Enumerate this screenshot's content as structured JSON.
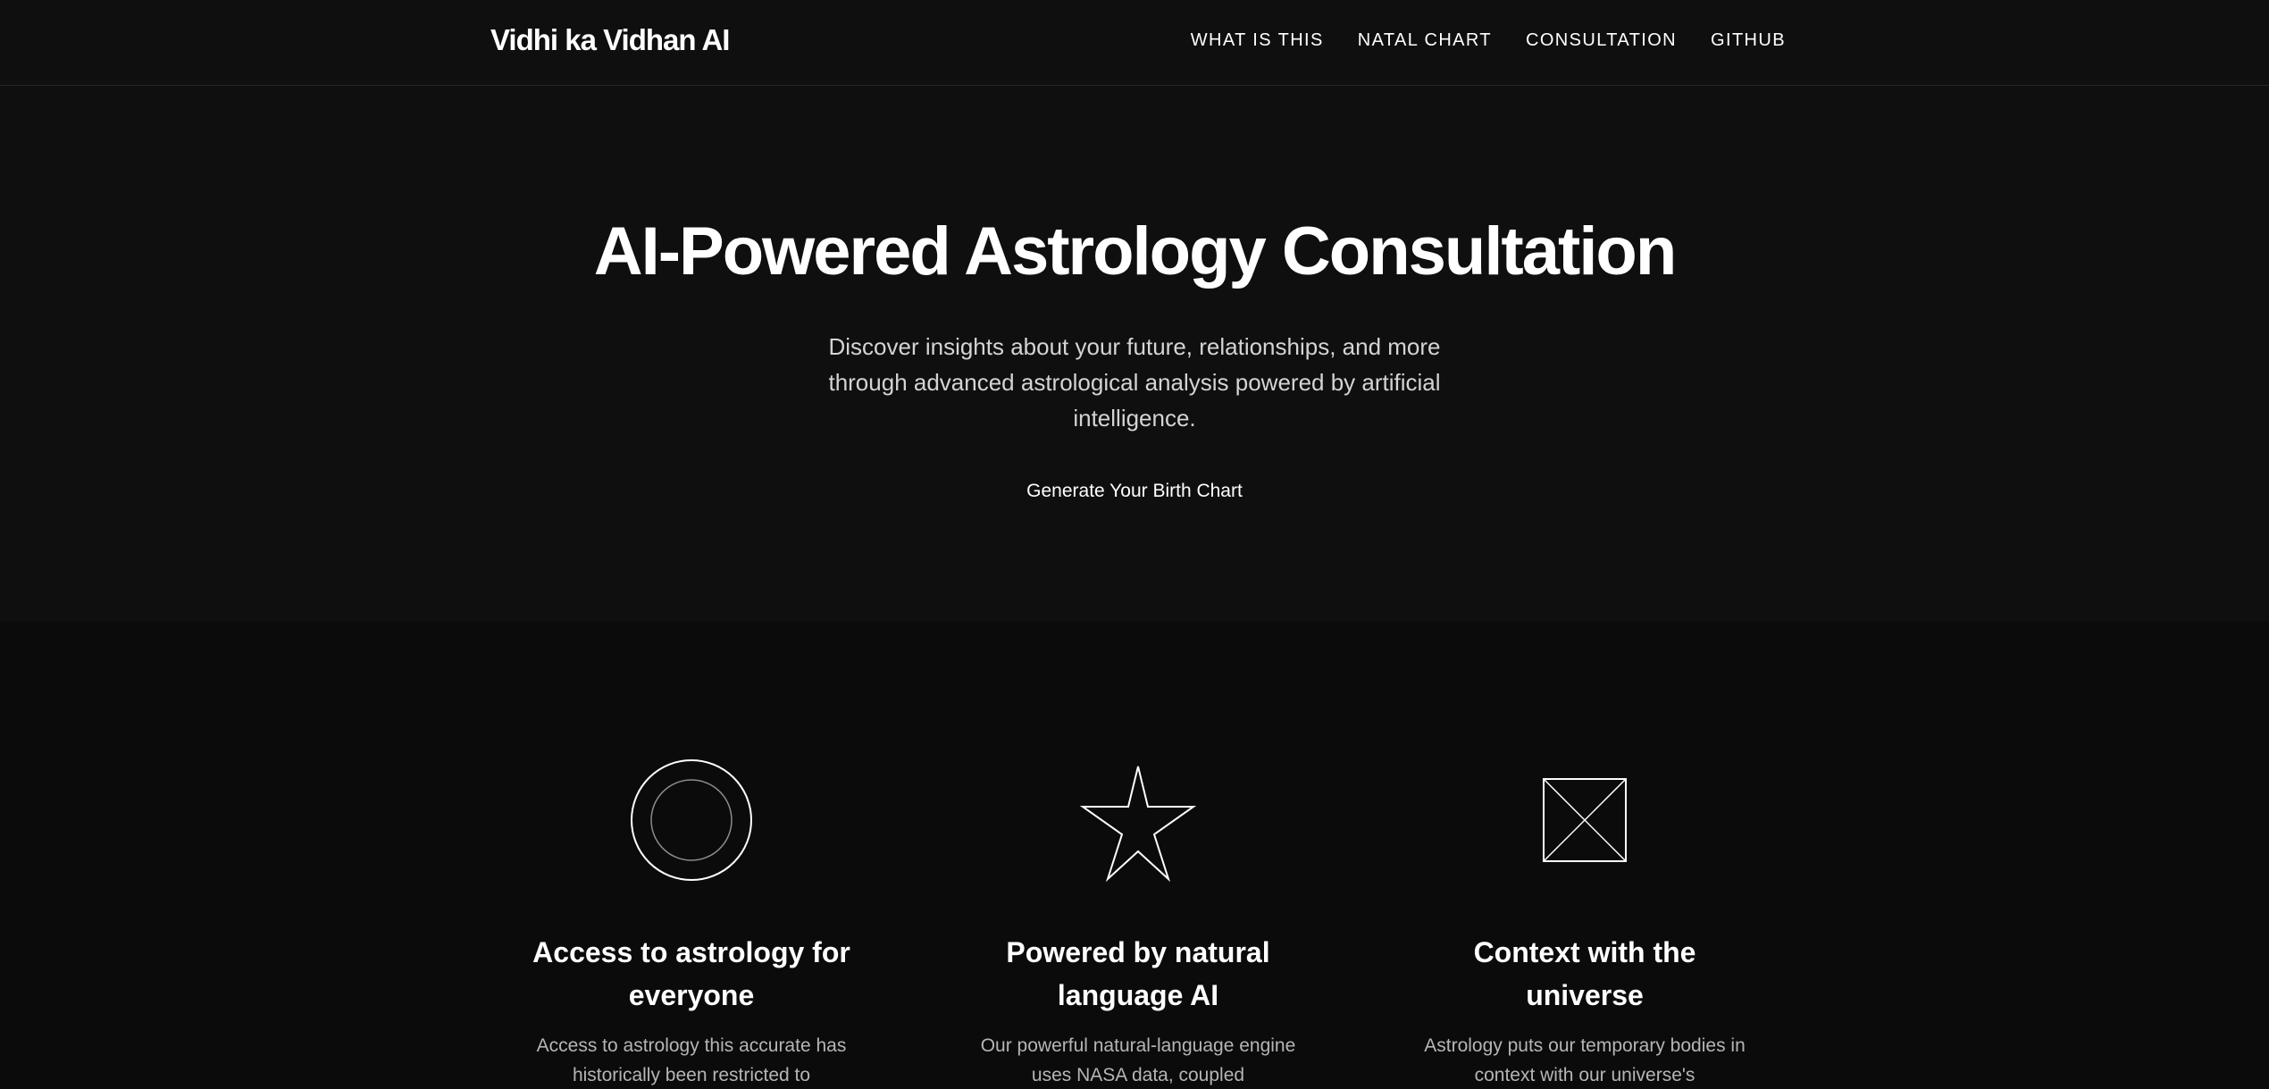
{
  "header": {
    "brand": "Vidhi ka Vidhan AI",
    "nav": [
      "WHAT IS THIS",
      "NATAL CHART",
      "CONSULTATION",
      "GITHUB"
    ]
  },
  "hero": {
    "title": "AI-Powered Astrology Consultation",
    "subtitle": "Discover insights about your future, relationships, and more through advanced astrological analysis powered by artificial intelligence.",
    "cta_label": "Generate Your Birth Chart"
  },
  "features": [
    {
      "icon": "double-circle-icon",
      "title": "Access to astrology for everyone",
      "body": "Access to astrology this accurate has historically been restricted to"
    },
    {
      "icon": "star-icon",
      "title": "Powered by natural language AI",
      "body": "Our powerful natural-language engine uses NASA data, coupled"
    },
    {
      "icon": "crossed-square-icon",
      "title": "Context with the universe",
      "body": "Astrology puts our temporary bodies in context with our universe's"
    }
  ],
  "colors": {
    "background": "#0f0f0f",
    "features_background": "#0b0b0b",
    "text_primary": "#ffffff",
    "text_secondary": "#d4d4d4",
    "text_muted": "#b5b5b5"
  }
}
